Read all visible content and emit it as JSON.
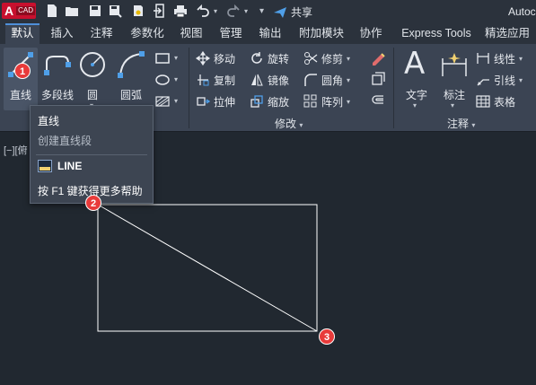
{
  "titlebar": {
    "app_logo_letter": "A",
    "app_logo_badge": "CAD",
    "share_label": "共享",
    "app_title": "Autoc"
  },
  "tabs": [
    "默认",
    "插入",
    "注释",
    "参数化",
    "视图",
    "管理",
    "输出",
    "附加模块",
    "协作",
    "Express Tools",
    "精选应用"
  ],
  "active_tab_index": 0,
  "ribbon": {
    "draw": {
      "line": "直线",
      "polyline": "多段线",
      "circle": "圆",
      "arc": "圆弧"
    },
    "modify": {
      "title": "修改",
      "move": "移动",
      "rotate": "旋转",
      "trim": "修剪",
      "copy": "复制",
      "mirror": "镜像",
      "fillet": "圆角",
      "stretch": "拉伸",
      "scale": "缩放",
      "array": "阵列"
    },
    "annotation": {
      "title": "注释",
      "text": "文字",
      "dimension": "标注",
      "linear": "线性",
      "leader": "引线",
      "table": "表格"
    }
  },
  "tooltip": {
    "title": "直线",
    "description": "创建直线段",
    "command": "LINE",
    "help": "按 F1 键获得更多帮助"
  },
  "viewport_label": "[−][俯",
  "markers": [
    "1",
    "2",
    "3"
  ],
  "colors": {
    "accent": "#4f8fd9",
    "marker": "#e83a3a",
    "logo": "#c8102e",
    "drawing_line": "#ffffff"
  }
}
